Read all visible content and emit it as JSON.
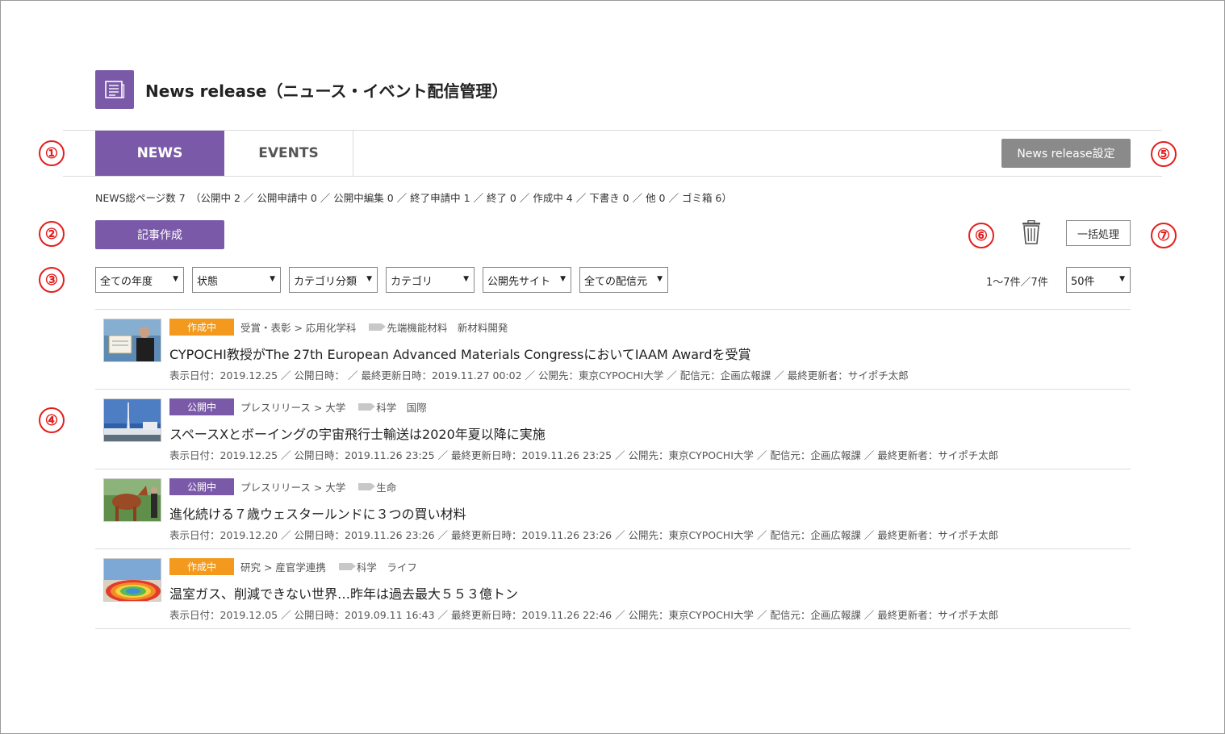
{
  "page": {
    "title": "News release（ニュース・イベント配信管理）"
  },
  "tabs": {
    "news": "NEWS",
    "events": "EVENTS"
  },
  "settings_button": "News release設定",
  "markers": [
    "①",
    "②",
    "③",
    "④",
    "⑤",
    "⑥",
    "⑦"
  ],
  "summary": "NEWS総ページ数 7　（公開中 2 ／ 公開申請中 0 ／ 公開中編集 0 ／ 終了申請中 1 ／ 終了 0 ／ 作成中 4 ／ 下書き 0 ／ 他 0 ／ ゴミ箱 6）",
  "create_button": "記事作成",
  "bulk_button": "一括処理",
  "filters": {
    "year": "全ての年度",
    "status": "状態",
    "category_group": "カテゴリ分類",
    "category": "カテゴリ",
    "site": "公開先サイト",
    "source": "全ての配信元",
    "per_page": "50件"
  },
  "count_label": "1～7件／7件",
  "articles": [
    {
      "status": "作成中",
      "category": "受賞・表彰 >  応用化学科",
      "tags": "先端機能材料　新材料開発",
      "title": "CYPOCHI教授がThe 27th European Advanced Materials CongressにおいてIAAM Awardを受賞",
      "meta": "表示日付：2019.12.25 ／ 公開日時：  ／ 最終更新日時：2019.11.27 00:02 ／ 公開先：東京CYPOCHI大学 ／ 配信元：企画広報課 ／ 最終更新者：サイポチ太郎"
    },
    {
      "status": "公開中",
      "category": "プレスリリース >  大学",
      "tags": "科学　国際",
      "title": "スペースXとボーイングの宇宙飛行士輸送は2020年夏以降に実施",
      "meta": "表示日付：2019.12.25 ／ 公開日時：2019.11.26 23:25 ／ 最終更新日時：2019.11.26 23:25 ／ 公開先：東京CYPOCHI大学 ／ 配信元：企画広報課 ／ 最終更新者：サイポチ太郎"
    },
    {
      "status": "公開中",
      "category": "プレスリリース >  大学",
      "tags": "生命",
      "title": "進化続ける７歳ウェスタールンドに３つの買い材料",
      "meta": "表示日付：2019.12.20 ／ 公開日時：2019.11.26 23:26 ／ 最終更新日時：2019.11.26 23:26 ／ 公開先：東京CYPOCHI大学 ／ 配信元：企画広報課 ／ 最終更新者：サイポチ太郎"
    },
    {
      "status": "作成中",
      "category": "研究 >  産官学連携",
      "tags": "科学　ライフ",
      "title": "温室ガス、削減できない世界…昨年は過去最大５５３億トン",
      "meta": "表示日付：2019.12.05 ／ 公開日時：2019.09.11 16:43 ／ 最終更新日時：2019.11.26 22:46 ／ 公開先：東京CYPOCHI大学 ／ 配信元：企画広報課 ／ 最終更新者：サイポチ太郎"
    }
  ],
  "colors": {
    "accent": "#7a5aa8",
    "draft": "#f39a1e",
    "settings": "#8a8a8a",
    "marker": "#e41e1e"
  },
  "icons": {
    "page": "newspaper-icon",
    "delete": "trash-icon",
    "tag": "tag-icon",
    "dropdown": "caret-down-icon"
  }
}
